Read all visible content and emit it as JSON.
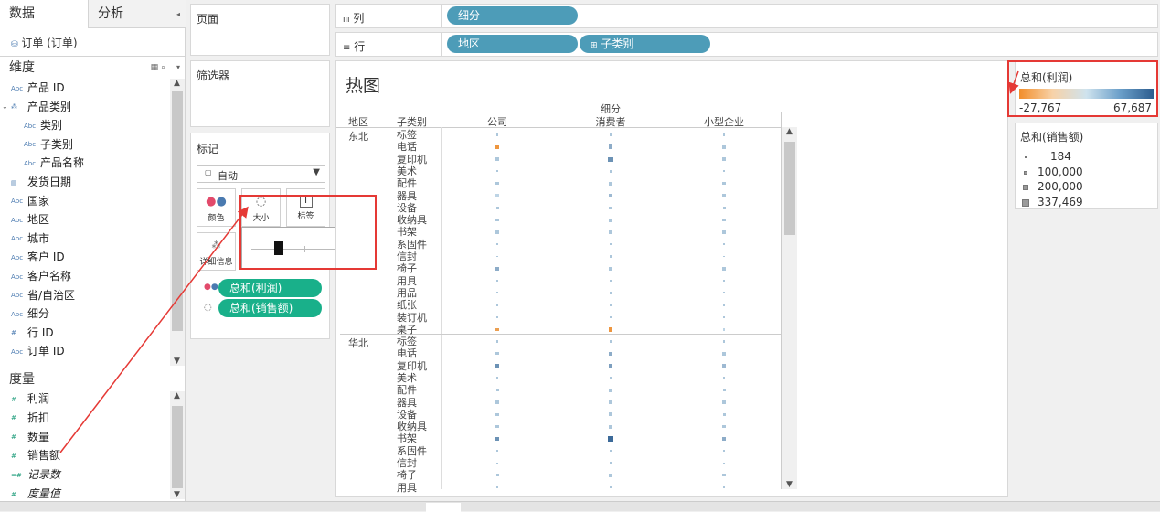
{
  "left_pane": {
    "tabs": [
      {
        "label": "数据"
      },
      {
        "label": "分析"
      }
    ],
    "datasource": "订单 (订单)",
    "dimensions_header": "维度",
    "dimensions": [
      {
        "label": "产品 ID",
        "icon": "Abc",
        "indent": 0
      },
      {
        "label": "产品类别",
        "icon": "hierarchy",
        "indent": 0
      },
      {
        "label": "类别",
        "icon": "Abc",
        "indent": 1
      },
      {
        "label": "子类别",
        "icon": "Abc",
        "indent": 1
      },
      {
        "label": "产品名称",
        "icon": "Abc",
        "indent": 1
      },
      {
        "label": "发货日期",
        "icon": "calendar",
        "indent": 0
      },
      {
        "label": "国家",
        "icon": "Abc",
        "indent": 0
      },
      {
        "label": "地区",
        "icon": "Abc",
        "indent": 0
      },
      {
        "label": "城市",
        "icon": "Abc",
        "indent": 0
      },
      {
        "label": "客户 ID",
        "icon": "Abc",
        "indent": 0
      },
      {
        "label": "客户名称",
        "icon": "Abc",
        "indent": 0
      },
      {
        "label": "省/自治区",
        "icon": "Abc",
        "indent": 0
      },
      {
        "label": "细分",
        "icon": "Abc",
        "indent": 0
      },
      {
        "label": "行 ID",
        "icon": "#",
        "indent": 0
      },
      {
        "label": "订单 ID",
        "icon": "Abc",
        "indent": 0
      }
    ],
    "measures_header": "度量",
    "measures": [
      {
        "label": "利润",
        "icon": "#"
      },
      {
        "label": "折扣",
        "icon": "#"
      },
      {
        "label": "数量",
        "icon": "#"
      },
      {
        "label": "销售额",
        "icon": "#"
      },
      {
        "label": "记录数",
        "icon": "=#"
      },
      {
        "label": "度量值",
        "icon": "#"
      }
    ]
  },
  "shelves": {
    "pages_label": "页面",
    "filters_label": "筛选器",
    "columns_label": "列",
    "rows_label": "行",
    "columns_pills": [
      "细分"
    ],
    "rows_pills": [
      "地区",
      "子类别"
    ]
  },
  "marks": {
    "title": "标记",
    "mark_type": "自动",
    "buttons": [
      {
        "label": "颜色",
        "icon": "color-icon"
      },
      {
        "label": "大小",
        "icon": "size-icon"
      },
      {
        "label": "标签",
        "icon": "label-icon"
      },
      {
        "label": "详细信息",
        "icon": "detail-icon"
      }
    ],
    "size_slider_value": 0.25,
    "pills": [
      {
        "label": "总和(利润)",
        "icon": "color-dots-icon"
      },
      {
        "label": "总和(销售额)",
        "icon": "size-icon"
      }
    ]
  },
  "viz": {
    "title": "热图",
    "col_header_top": "细分",
    "row_field_1": "地区",
    "row_field_2": "子类别",
    "columns": [
      "公司",
      "消费者",
      "小型企业"
    ],
    "regions": [
      "东北",
      "华北"
    ],
    "subcategories": [
      "标签",
      "电话",
      "复印机",
      "美术",
      "配件",
      "器具",
      "设备",
      "收纳具",
      "书架",
      "系固件",
      "信封",
      "椅子",
      "用具",
      "用品",
      "纸张",
      "装订机",
      "桌子"
    ]
  },
  "legends": {
    "color": {
      "title": "总和(利润)",
      "min": "-27,767",
      "max": "67,687",
      "low_color": "#f28e2b",
      "high_color": "#2c5d8f"
    },
    "size": {
      "title": "总和(销售额)",
      "items": [
        "184",
        "100,000",
        "200,000",
        "337,469"
      ]
    }
  },
  "chart_data": {
    "type": "heatmap",
    "title": "热图",
    "x_field": "细分",
    "columns": [
      "公司",
      "消费者",
      "小型企业"
    ],
    "cells": [
      {
        "region": "东北",
        "subcategory": "标签",
        "values": [
          {
            "size": 0.1,
            "profit": 0.6
          },
          {
            "size": 0.1,
            "profit": 0.6
          },
          {
            "size": 0.1,
            "profit": 0.6
          }
        ]
      },
      {
        "region": "东北",
        "subcategory": "电话",
        "values": [
          {
            "size": 0.5,
            "profit": 0.05
          },
          {
            "size": 0.55,
            "profit": 0.7
          },
          {
            "size": 0.35,
            "profit": 0.6
          }
        ]
      },
      {
        "region": "东北",
        "subcategory": "复印机",
        "values": [
          {
            "size": 0.35,
            "profit": 0.6
          },
          {
            "size": 0.6,
            "profit": 0.8
          },
          {
            "size": 0.3,
            "profit": 0.6
          }
        ]
      },
      {
        "region": "东北",
        "subcategory": "美术",
        "values": [
          {
            "size": 0.1,
            "profit": 0.6
          },
          {
            "size": 0.15,
            "profit": 0.6
          },
          {
            "size": 0.1,
            "profit": 0.6
          }
        ]
      },
      {
        "region": "东北",
        "subcategory": "配件",
        "values": [
          {
            "size": 0.3,
            "profit": 0.6
          },
          {
            "size": 0.45,
            "profit": 0.6
          },
          {
            "size": 0.35,
            "profit": 0.6
          }
        ]
      },
      {
        "region": "东北",
        "subcategory": "器具",
        "values": [
          {
            "size": 0.4,
            "profit": 0.55
          },
          {
            "size": 0.55,
            "profit": 0.65
          },
          {
            "size": 0.3,
            "profit": 0.6
          }
        ]
      },
      {
        "region": "东北",
        "subcategory": "设备",
        "values": [
          {
            "size": 0.25,
            "profit": 0.6
          },
          {
            "size": 0.35,
            "profit": 0.6
          },
          {
            "size": 0.25,
            "profit": 0.6
          }
        ]
      },
      {
        "region": "东北",
        "subcategory": "收纳具",
        "values": [
          {
            "size": 0.35,
            "profit": 0.6
          },
          {
            "size": 0.45,
            "profit": 0.6
          },
          {
            "size": 0.35,
            "profit": 0.6
          }
        ]
      },
      {
        "region": "东北",
        "subcategory": "书架",
        "values": [
          {
            "size": 0.3,
            "profit": 0.6
          },
          {
            "size": 0.5,
            "profit": 0.6
          },
          {
            "size": 0.35,
            "profit": 0.6
          }
        ]
      },
      {
        "region": "东北",
        "subcategory": "系固件",
        "values": [
          {
            "size": 0.1,
            "profit": 0.6
          },
          {
            "size": 0.1,
            "profit": 0.6
          },
          {
            "size": 0.05,
            "profit": 0.6
          }
        ]
      },
      {
        "region": "东北",
        "subcategory": "信封",
        "values": [
          {
            "size": 0.05,
            "profit": 0.6
          },
          {
            "size": 0.2,
            "profit": 0.6
          },
          {
            "size": 0.05,
            "profit": 0.6
          }
        ]
      },
      {
        "region": "东北",
        "subcategory": "椅子",
        "values": [
          {
            "size": 0.45,
            "profit": 0.7
          },
          {
            "size": 0.5,
            "profit": 0.6
          },
          {
            "size": 0.35,
            "profit": 0.6
          }
        ]
      },
      {
        "region": "东北",
        "subcategory": "用具",
        "values": [
          {
            "size": 0.15,
            "profit": 0.6
          },
          {
            "size": 0.2,
            "profit": 0.6
          },
          {
            "size": 0.1,
            "profit": 0.6
          }
        ]
      },
      {
        "region": "东北",
        "subcategory": "用品",
        "values": [
          {
            "size": 0.1,
            "profit": 0.6
          },
          {
            "size": 0.2,
            "profit": 0.6
          },
          {
            "size": 0.1,
            "profit": 0.6
          }
        ]
      },
      {
        "region": "东北",
        "subcategory": "纸张",
        "values": [
          {
            "size": 0.1,
            "profit": 0.6
          },
          {
            "size": 0.15,
            "profit": 0.6
          },
          {
            "size": 0.1,
            "profit": 0.6
          }
        ]
      },
      {
        "region": "东北",
        "subcategory": "装订机",
        "values": [
          {
            "size": 0.15,
            "profit": 0.6
          },
          {
            "size": 0.2,
            "profit": 0.6
          },
          {
            "size": 0.1,
            "profit": 0.6
          }
        ]
      },
      {
        "region": "东北",
        "subcategory": "桌子",
        "values": [
          {
            "size": 0.3,
            "profit": 0.1
          },
          {
            "size": 0.5,
            "profit": 0.05
          },
          {
            "size": 0.2,
            "profit": 0.55
          }
        ]
      },
      {
        "region": "华北",
        "subcategory": "标签",
        "values": [
          {
            "size": 0.1,
            "profit": 0.6
          },
          {
            "size": 0.1,
            "profit": 0.6
          },
          {
            "size": 0.1,
            "profit": 0.6
          }
        ]
      },
      {
        "region": "华北",
        "subcategory": "电话",
        "values": [
          {
            "size": 0.3,
            "profit": 0.6
          },
          {
            "size": 0.45,
            "profit": 0.7
          },
          {
            "size": 0.35,
            "profit": 0.6
          }
        ]
      },
      {
        "region": "华北",
        "subcategory": "复印机",
        "values": [
          {
            "size": 0.45,
            "profit": 0.8
          },
          {
            "size": 0.45,
            "profit": 0.75
          },
          {
            "size": 0.3,
            "profit": 0.65
          }
        ]
      },
      {
        "region": "华北",
        "subcategory": "美术",
        "values": [
          {
            "size": 0.1,
            "profit": 0.6
          },
          {
            "size": 0.15,
            "profit": 0.6
          },
          {
            "size": 0.1,
            "profit": 0.6
          }
        ]
      },
      {
        "region": "华北",
        "subcategory": "配件",
        "values": [
          {
            "size": 0.25,
            "profit": 0.6
          },
          {
            "size": 0.4,
            "profit": 0.6
          },
          {
            "size": 0.25,
            "profit": 0.6
          }
        ]
      },
      {
        "region": "华北",
        "subcategory": "器具",
        "values": [
          {
            "size": 0.3,
            "profit": 0.6
          },
          {
            "size": 0.5,
            "profit": 0.6
          },
          {
            "size": 0.35,
            "profit": 0.6
          }
        ]
      },
      {
        "region": "华北",
        "subcategory": "设备",
        "values": [
          {
            "size": 0.3,
            "profit": 0.6
          },
          {
            "size": 0.45,
            "profit": 0.6
          },
          {
            "size": 0.25,
            "profit": 0.6
          }
        ]
      },
      {
        "region": "华北",
        "subcategory": "收纳具",
        "values": [
          {
            "size": 0.35,
            "profit": 0.6
          },
          {
            "size": 0.45,
            "profit": 0.6
          },
          {
            "size": 0.3,
            "profit": 0.6
          }
        ]
      },
      {
        "region": "华北",
        "subcategory": "书架",
        "values": [
          {
            "size": 0.5,
            "profit": 0.8
          },
          {
            "size": 0.75,
            "profit": 0.95
          },
          {
            "size": 0.4,
            "profit": 0.7
          }
        ]
      },
      {
        "region": "华北",
        "subcategory": "系固件",
        "values": [
          {
            "size": 0.1,
            "profit": 0.6
          },
          {
            "size": 0.1,
            "profit": 0.6
          },
          {
            "size": 0.05,
            "profit": 0.6
          }
        ]
      },
      {
        "region": "华北",
        "subcategory": "信封",
        "values": [
          {
            "size": 0.05,
            "profit": 0.6
          },
          {
            "size": 0.15,
            "profit": 0.6
          },
          {
            "size": 0.05,
            "profit": 0.6
          }
        ]
      },
      {
        "region": "华北",
        "subcategory": "椅子",
        "values": [
          {
            "size": 0.25,
            "profit": 0.6
          },
          {
            "size": 0.45,
            "profit": 0.6
          },
          {
            "size": 0.3,
            "profit": 0.6
          }
        ]
      },
      {
        "region": "华北",
        "subcategory": "用具",
        "values": [
          {
            "size": 0.15,
            "profit": 0.6
          },
          {
            "size": 0.2,
            "profit": 0.6
          },
          {
            "size": 0.1,
            "profit": 0.6
          }
        ]
      }
    ]
  }
}
